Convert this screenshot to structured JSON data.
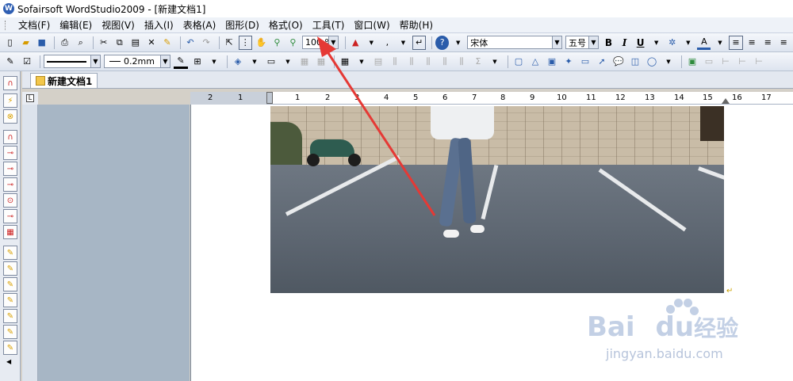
{
  "window": {
    "title": "Sofairsoft WordStudio2009 - [新建文档1]",
    "app_icon": "W"
  },
  "menu": [
    "文档(F)",
    "编辑(E)",
    "视图(V)",
    "插入(I)",
    "表格(A)",
    "图形(D)",
    "格式(O)",
    "工具(T)",
    "窗口(W)",
    "帮助(H)"
  ],
  "toolbar1": {
    "zoom": "100 %",
    "font": "宋体",
    "font_size": "五号",
    "bold": "B",
    "italic": "I",
    "underline": "U"
  },
  "toolbar2": {
    "line_width": "0.2mm"
  },
  "tabs": [
    "新建文档1"
  ],
  "ruler": {
    "numbers": [
      "2",
      "1",
      "1",
      "2",
      "3",
      "4",
      "5",
      "6",
      "7",
      "8",
      "9",
      "10",
      "11",
      "12",
      "13",
      "14",
      "15",
      "16",
      "17"
    ],
    "corner": "L"
  },
  "document": {
    "paragraph_mark": "↵"
  },
  "watermark": {
    "brand": "Bai",
    "brand2": "du",
    "cn": "经验",
    "url": "jingyan.baidu.com"
  },
  "colors": {
    "annotation_arrow": "#e53935",
    "page_bg": "#ffffff",
    "left_pane": "#a7b6c5"
  }
}
